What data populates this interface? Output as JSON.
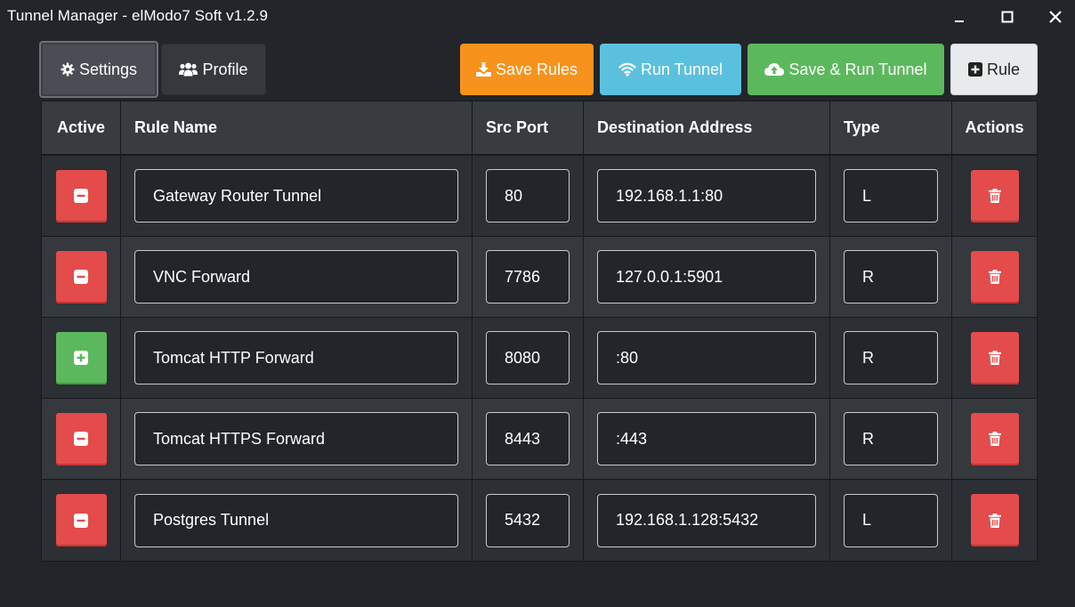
{
  "window": {
    "title": "Tunnel Manager - elModo7 Soft v1.2.9"
  },
  "toolbar": {
    "settings_label": "Settings",
    "profile_label": "Profile",
    "save_rules_label": "Save Rules",
    "run_tunnel_label": "Run Tunnel",
    "save_run_label": "Save & Run Tunnel",
    "add_rule_label": "Rule"
  },
  "table": {
    "headers": {
      "active": "Active",
      "rule_name": "Rule Name",
      "src_port": "Src Port",
      "destination": "Destination Address",
      "type": "Type",
      "actions": "Actions"
    },
    "rows": [
      {
        "active": false,
        "name": "Gateway Router Tunnel",
        "port": "80",
        "dest": "192.168.1.1:80",
        "type": "L"
      },
      {
        "active": false,
        "name": "VNC Forward",
        "port": "7786",
        "dest": "127.0.0.1:5901",
        "type": "R"
      },
      {
        "active": true,
        "name": "Tomcat HTTP Forward",
        "port": "8080",
        "dest": ":80",
        "type": "R"
      },
      {
        "active": false,
        "name": "Tomcat HTTPS Forward",
        "port": "8443",
        "dest": ":443",
        "type": "R"
      },
      {
        "active": false,
        "name": "Postgres Tunnel",
        "port": "5432",
        "dest": "192.168.1.128:5432",
        "type": "L"
      }
    ]
  },
  "colors": {
    "background": "#222529",
    "danger": "#e44b4b",
    "success": "#5cb85c",
    "warning": "#f7931c",
    "info": "#5bc0de"
  },
  "icons": {
    "settings": "gear-icon",
    "profile": "users-icon",
    "save": "download-icon",
    "run": "wifi-icon",
    "save_run": "cloud-upload-icon",
    "add_rule": "plus-square-icon",
    "inactive": "minus-square-icon",
    "active": "plus-square-icon",
    "delete": "trash-icon"
  }
}
